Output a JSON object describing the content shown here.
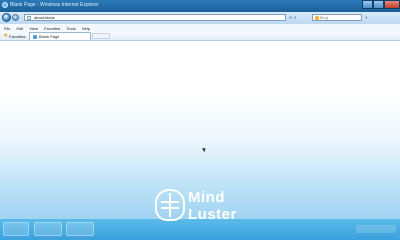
{
  "window": {
    "title": "Blank Page - Windows Internet Explorer"
  },
  "address_bar": {
    "url": "about:blank"
  },
  "search": {
    "placeholder": "Bing"
  },
  "menu": {
    "items": [
      "File",
      "Edit",
      "View",
      "Favorites",
      "Tools",
      "Help"
    ]
  },
  "favorites_bar": {
    "label": "Favorites"
  },
  "tabs": [
    {
      "label": "Blank Page"
    }
  ],
  "watermark": {
    "line1": "Mind",
    "line2": "Luster"
  }
}
